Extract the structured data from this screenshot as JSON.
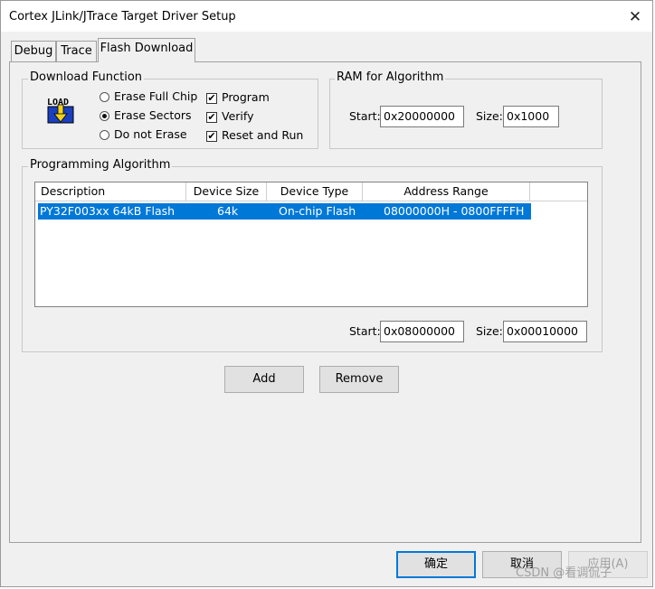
{
  "window": {
    "title": "Cortex JLink/JTrace Target Driver Setup",
    "close_glyph": "✕"
  },
  "tabs": [
    {
      "label": "Debug"
    },
    {
      "label": "Trace"
    },
    {
      "label": "Flash Download",
      "active": true
    }
  ],
  "download_function": {
    "legend": "Download Function",
    "icon_text": "LOAD",
    "radios": [
      {
        "label": "Erase Full Chip",
        "selected": false
      },
      {
        "label": "Erase Sectors",
        "selected": true
      },
      {
        "label": "Do not Erase",
        "selected": false
      }
    ],
    "checks": [
      {
        "label": "Program",
        "checked": true,
        "mark": "✔"
      },
      {
        "label": "Verify",
        "checked": true,
        "mark": "✔"
      },
      {
        "label": "Reset and Run",
        "checked": true,
        "mark": "✔"
      }
    ]
  },
  "ram": {
    "legend": "RAM for Algorithm",
    "start_label": "Start:",
    "start_value": "0x20000000",
    "size_label": "Size:",
    "size_value": "0x1000"
  },
  "programming_algorithm": {
    "legend": "Programming Algorithm",
    "columns": [
      "Description",
      "Device Size",
      "Device Type",
      "Address Range"
    ],
    "rows": [
      {
        "description": "PY32F003xx 64kB Flash",
        "device_size": "64k",
        "device_type": "On-chip Flash",
        "address_range": "08000000H - 0800FFFFH"
      }
    ],
    "start_label": "Start:",
    "start_value": "0x08000000",
    "size_label": "Size:",
    "size_value": "0x00010000"
  },
  "buttons": {
    "add": "Add",
    "remove": "Remove",
    "ok": "确定",
    "cancel": "取消",
    "apply": "应用(A)"
  },
  "watermark": "CSDN @看调侃子",
  "colors": {
    "selection": "#0078d7",
    "icon_blue": "#1a3fbf",
    "icon_yellow": "#f2d21a"
  }
}
